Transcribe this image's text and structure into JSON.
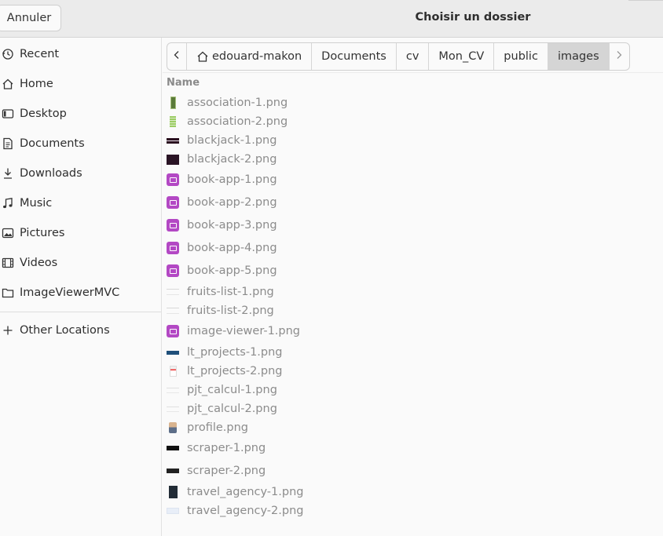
{
  "header": {
    "cancel_label": "Annuler",
    "title": "Choisir un dossier"
  },
  "sidebar": {
    "items": [
      {
        "label": "Recent",
        "icon": "clock-icon"
      },
      {
        "label": "Home",
        "icon": "home-icon"
      },
      {
        "label": "Desktop",
        "icon": "desktop-icon"
      },
      {
        "label": "Documents",
        "icon": "document-icon"
      },
      {
        "label": "Downloads",
        "icon": "download-icon"
      },
      {
        "label": "Music",
        "icon": "music-icon"
      },
      {
        "label": "Pictures",
        "icon": "picture-icon"
      },
      {
        "label": "Videos",
        "icon": "film-icon"
      },
      {
        "label": "ImageViewerMVC",
        "icon": "folder-icon"
      }
    ],
    "other_locations": {
      "label": "Other Locations",
      "icon": "plus-icon"
    }
  },
  "pathbar": {
    "crumbs": [
      "edouard-makon",
      "Documents",
      "cv",
      "Mon_CV",
      "public",
      "images"
    ],
    "active": "images"
  },
  "list": {
    "column_name": "Name",
    "files": [
      "association-1.png",
      "association-2.png",
      "blackjack-1.png",
      "blackjack-2.png",
      "book-app-1.png",
      "book-app-2.png",
      "book-app-3.png",
      "book-app-4.png",
      "book-app-5.png",
      "fruits-list-1.png",
      "fruits-list-2.png",
      "image-viewer-1.png",
      "lt_projects-1.png",
      "lt_projects-2.png",
      "pjt_calcul-1.png",
      "pjt_calcul-2.png",
      "profile.png",
      "scraper-1.png",
      "scraper-2.png",
      "travel_agency-1.png",
      "travel_agency-2.png"
    ]
  },
  "colors": {
    "headerbar": "#ebebeb",
    "background": "#fafafa",
    "active_crumb": "#d5d5d5",
    "dim_text": "#8c8c8c",
    "image_thumb": "#b348c4"
  }
}
